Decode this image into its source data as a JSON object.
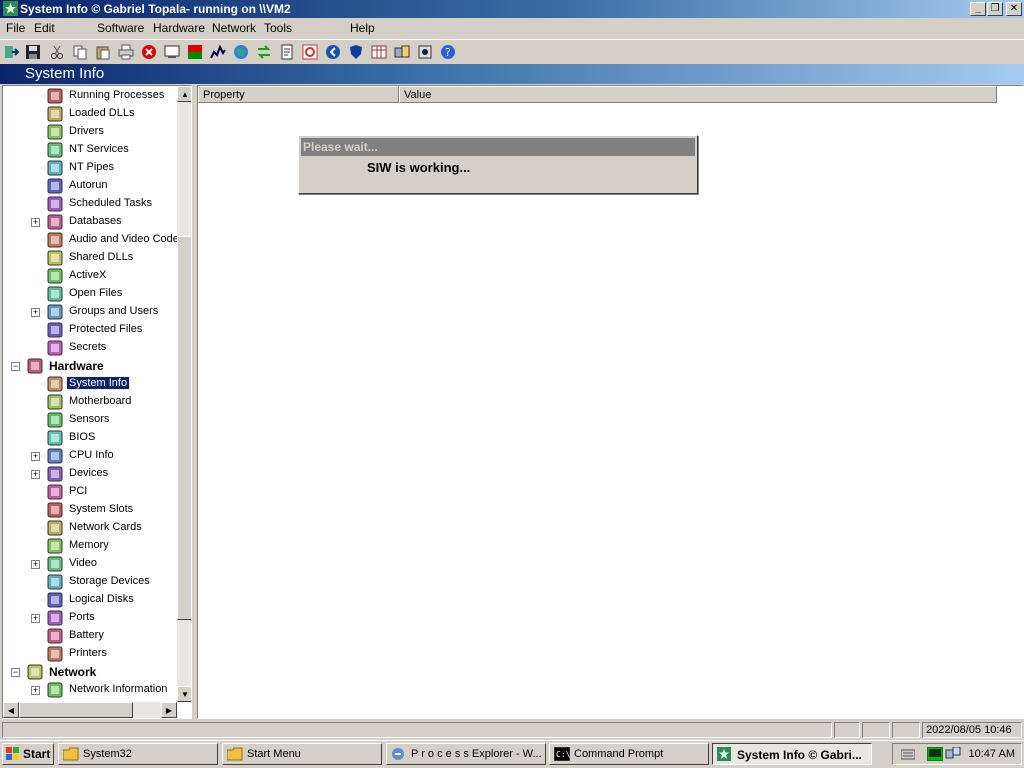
{
  "window": {
    "title": "System Info  © Gabriel Topala- running on \\\\VM2",
    "buttons": {
      "minimize": "_",
      "restore": "❐",
      "close": "✕"
    }
  },
  "menu": [
    {
      "label": "File"
    },
    {
      "label": "Edit"
    },
    {
      "label": "Software"
    },
    {
      "label": "Hardware"
    },
    {
      "label": "Network"
    },
    {
      "label": "Tools"
    },
    {
      "label": "Help"
    }
  ],
  "toolbar": {
    "icons": [
      "exit-icon",
      "save-icon",
      "cut-icon",
      "copy-icon",
      "paste-icon",
      "print-icon",
      "stop-icon",
      "preview-icon",
      "report-icon",
      "chart-icon",
      "globe-icon",
      "refresh-icon",
      "document-icon",
      "settings-icon",
      "back-icon",
      "shield-icon",
      "table-icon",
      "network-icon",
      "info-icon",
      "help-icon"
    ]
  },
  "header": {
    "title": "System Info"
  },
  "tree": {
    "items": [
      {
        "label": "Running Processes",
        "icon": "process-icon"
      },
      {
        "label": "Loaded DLLs",
        "icon": "dll-icon"
      },
      {
        "label": "Drivers",
        "icon": "driver-icon"
      },
      {
        "label": "NT Services",
        "icon": "services-icon"
      },
      {
        "label": "NT Pipes",
        "icon": "pipe-icon"
      },
      {
        "label": "Autorun",
        "icon": "autorun-icon"
      },
      {
        "label": "Scheduled Tasks",
        "icon": "tasks-icon"
      },
      {
        "label": "Databases",
        "icon": "database-icon",
        "expandable": true
      },
      {
        "label": "Audio and Video Codecs",
        "icon": "codec-icon"
      },
      {
        "label": "Shared DLLs",
        "icon": "shared-dll-icon"
      },
      {
        "label": "ActiveX",
        "icon": "activex-icon"
      },
      {
        "label": "Open Files",
        "icon": "file-icon"
      },
      {
        "label": "Groups and Users",
        "icon": "users-icon",
        "expandable": true
      },
      {
        "label": "Protected Files",
        "icon": "protected-file-icon"
      },
      {
        "label": "Secrets",
        "icon": "secrets-icon"
      },
      {
        "label": "Hardware",
        "icon": "hardware-icon",
        "category": true
      },
      {
        "label": "System Info",
        "icon": "system-info-icon",
        "selected": true
      },
      {
        "label": "Motherboard",
        "icon": "motherboard-icon"
      },
      {
        "label": "Sensors",
        "icon": "sensors-icon"
      },
      {
        "label": "BIOS",
        "icon": "bios-icon"
      },
      {
        "label": "CPU Info",
        "icon": "cpu-icon",
        "expandable": true
      },
      {
        "label": "Devices",
        "icon": "devices-icon",
        "expandable": true
      },
      {
        "label": "PCI",
        "icon": "pci-icon"
      },
      {
        "label": "System Slots",
        "icon": "slots-icon"
      },
      {
        "label": "Network Cards",
        "icon": "network-card-icon"
      },
      {
        "label": "Memory",
        "icon": "memory-icon"
      },
      {
        "label": "Video",
        "icon": "video-icon",
        "expandable": true
      },
      {
        "label": "Storage Devices",
        "icon": "storage-icon"
      },
      {
        "label": "Logical Disks",
        "icon": "disk-icon"
      },
      {
        "label": "Ports",
        "icon": "ports-icon",
        "expandable": true
      },
      {
        "label": "Battery",
        "icon": "battery-icon"
      },
      {
        "label": "Printers",
        "icon": "printer-icon"
      },
      {
        "label": "Network",
        "icon": "network-icon",
        "category": true
      },
      {
        "label": "Network Information",
        "icon": "network-info-icon",
        "expandable": true
      }
    ]
  },
  "list": {
    "columns": [
      "Property",
      "Value"
    ]
  },
  "dialog": {
    "title": "Please wait...",
    "message": "SIW is working..."
  },
  "statusbar": {
    "datetime": "2022/08/05 10:46"
  },
  "taskbar": {
    "start": "Start",
    "tasks": [
      {
        "label": "System32",
        "icon": "folder-icon"
      },
      {
        "label": "Start Menu",
        "icon": "folder-icon"
      },
      {
        "label": "P r o c e s s  Explorer - W...",
        "icon": "process-explorer-icon"
      },
      {
        "label": "Command Prompt",
        "icon": "cmd-icon"
      },
      {
        "label": "System Info  © Gabri...",
        "icon": "siw-icon",
        "active": true
      }
    ],
    "clock": "10:47 AM"
  }
}
